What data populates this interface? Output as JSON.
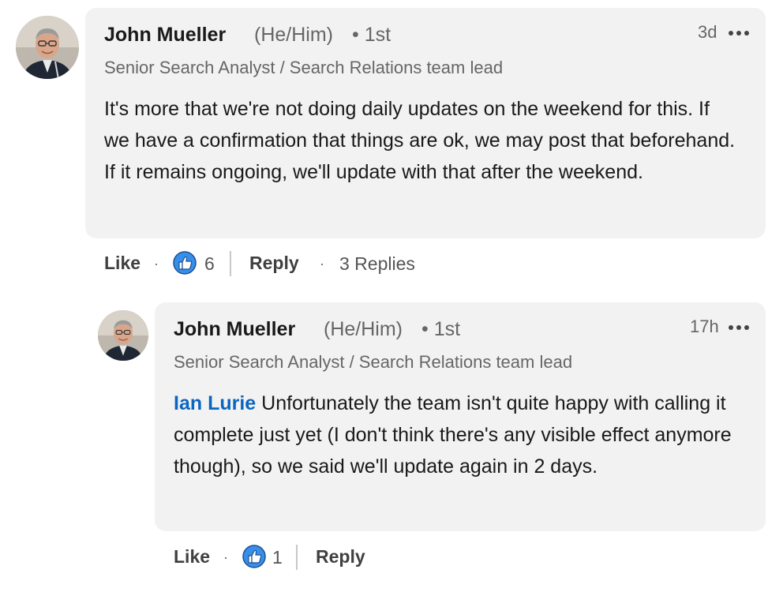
{
  "comment": {
    "author": "John Mueller",
    "pronouns": "(He/Him)",
    "degree": "• 1st",
    "headline": "Senior Search Analyst / Search Relations team lead",
    "time": "3d",
    "text": "It's more that we're not doing daily updates on the weekend for this. If we have a confirmation that things are ok, we may post that beforehand. If it remains ongoing, we'll update with that after the weekend.",
    "like_label": "Like",
    "reaction_icon": "thumbs-up-icon",
    "reaction_count": "6",
    "reply_label": "Reply",
    "replies_label": "3 Replies"
  },
  "reply": {
    "author": "John Mueller",
    "pronouns": "(He/Him)",
    "degree": "• 1st",
    "headline": "Senior Search Analyst / Search Relations team lead",
    "time": "17h",
    "mention": "Ian Lurie",
    "text": " Unfortunately the team isn't quite happy with calling it complete just yet (I don't think there's any visible effect anymore though), so we said we'll update again in 2 days.",
    "like_label": "Like",
    "reaction_icon": "thumbs-up-icon",
    "reaction_count": "1",
    "reply_label": "Reply"
  },
  "colors": {
    "bubble": "#f2f2f2",
    "mention": "#0a66c2",
    "like_blue": "#378fe9"
  }
}
